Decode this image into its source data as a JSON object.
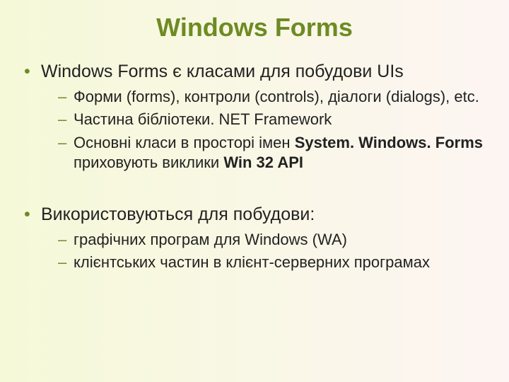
{
  "title": "Windows Forms",
  "bullets": {
    "b1": {
      "text": "Windows Forms є класами для побудови UIs",
      "sub": {
        "s1": "Форми (forms), контроли (controls), діалоги (dialogs), etc.",
        "s2": "Частина бібліотеки. NET Framework",
        "s3_a": "Основні класи в просторі імен ",
        "s3_b": "System. Windows. Forms",
        "s3_c": " приховують виклики ",
        "s3_d": "Win 32 API"
      }
    },
    "b2": {
      "text": "Використовуються для побудови:",
      "sub": {
        "s1": "графічних програм для Windows (WA)",
        "s2": "клієнтських частин в клієнт-серверних програмах"
      }
    }
  }
}
